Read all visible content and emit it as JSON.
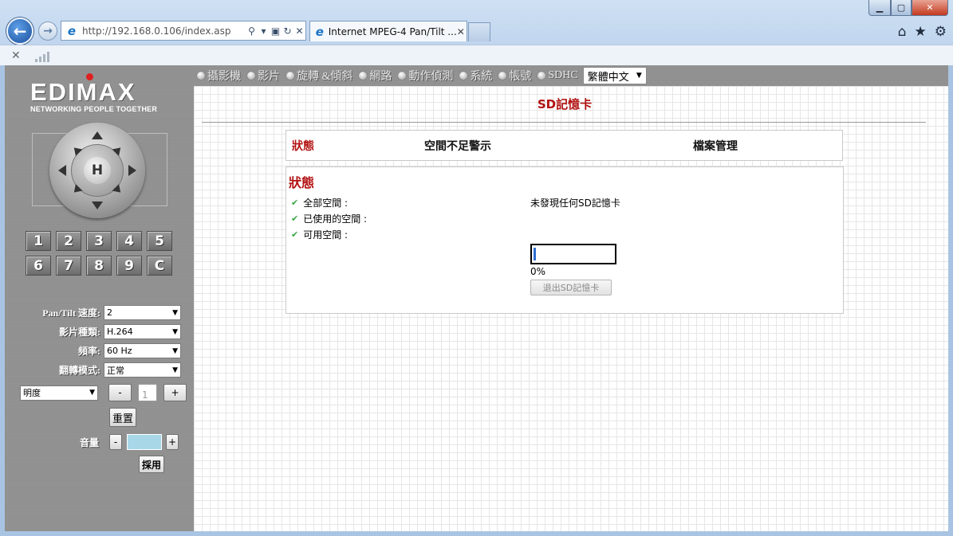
{
  "browser": {
    "address": "http://192.168.0.106/index.asp",
    "tab_title": "Internet MPEG-4 Pan/Tilt ...",
    "window_controls": [
      "minimize-icon",
      "maximize-icon",
      "close-icon"
    ],
    "toolbar_icons": [
      "home-icon",
      "favorites-star-icon",
      "settings-gear-icon"
    ]
  },
  "logo": {
    "brand": "EDIMAX",
    "tagline": "NETWORKING PEOPLE TOGETHER"
  },
  "ptz": {
    "home_label": "H"
  },
  "presets": [
    "1",
    "2",
    "3",
    "4",
    "5",
    "6",
    "7",
    "8",
    "9",
    "C"
  ],
  "controls": {
    "pantilt_speed": {
      "label": "Pan/Tilt 速度:",
      "value": "2"
    },
    "video_type": {
      "label": "影片種類:",
      "value": "H.264"
    },
    "frequency": {
      "label": "頻率:",
      "value": "60 Hz"
    },
    "flip_mode": {
      "label": "翻轉模式:",
      "value": "正常"
    },
    "brightness": {
      "value": "明度",
      "minus": "-",
      "input": "1",
      "plus": "+"
    },
    "reset_label": "重置",
    "volume": {
      "label": "音量",
      "minus": "-",
      "plus": "+"
    },
    "apply_label": "採用"
  },
  "menu": {
    "items": [
      "攝影機",
      "影片",
      "旋轉 &傾斜",
      "網路",
      "動作偵測",
      "系統",
      "帳號",
      "SDHC"
    ],
    "language": "繁體中文"
  },
  "content": {
    "title": "SD記憶卡",
    "subtabs": [
      "狀態",
      "空間不足警示",
      "檔案管理"
    ],
    "section_title": "狀態",
    "fields": [
      "全部空間 :",
      "已使用的空間 :",
      "可用空間 :"
    ],
    "no_card": "未發現任何SD記憶卡",
    "progress_value": 0,
    "progress_label": "0%",
    "eject_label": "退出SD記憶卡"
  },
  "colors": {
    "accent_red": "#b21212",
    "sidebar_gray": "#8f8f8f",
    "progress_blue": "#2f6dd1"
  }
}
